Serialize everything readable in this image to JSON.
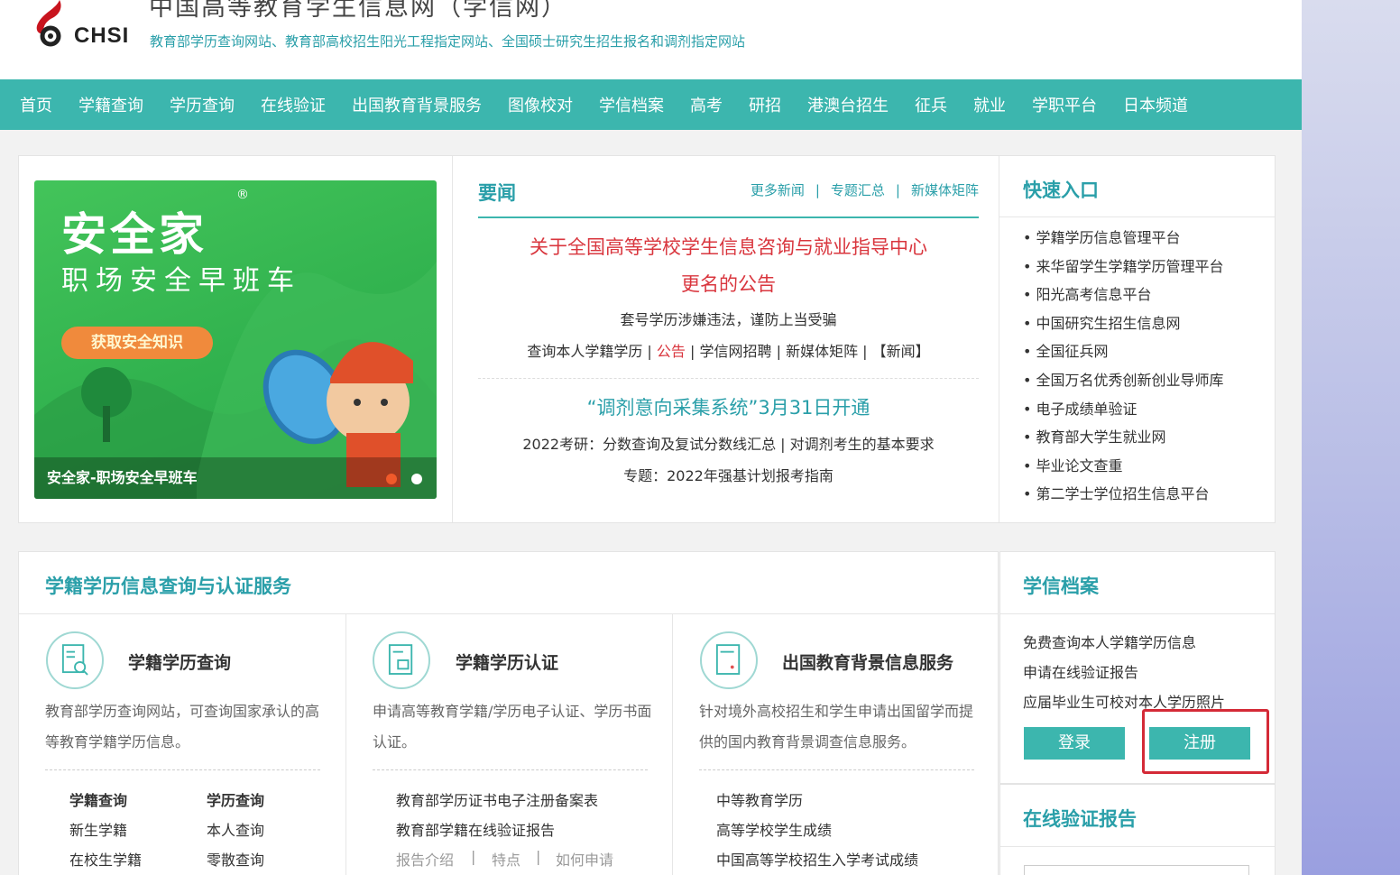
{
  "header": {
    "logo_text": "CHSI",
    "site_title": "中国高等教育学生信息网（学信网）",
    "site_subtitle": "教育部学历查询网站、教育部高校招生阳光工程指定网站、全国硕士研究生招生报名和调剂指定网站"
  },
  "nav": {
    "items": [
      "首页",
      "学籍查询",
      "学历查询",
      "在线验证",
      "出国教育背景服务",
      "图像校对",
      "学信档案",
      "高考",
      "研招",
      "港澳台招生",
      "征兵",
      "就业",
      "学职平台",
      "日本频道"
    ]
  },
  "banner": {
    "title": "安全家",
    "registered": "®",
    "subtitle": "职场安全早班车",
    "button": "获取安全知识",
    "caption": "安全家-职场安全早班车"
  },
  "news": {
    "title": "要闻",
    "links": [
      "更多新闻",
      "专题汇总",
      "新媒体矩阵"
    ],
    "separator": "|",
    "headline1_line1": "关于全国高等学校学生信息咨询与就业指导中心",
    "headline1_line2": "更名的公告",
    "line1": "套号学历涉嫌违法，谨防上当受骗",
    "line2_a": "查询本人学籍学历 | ",
    "line2_red": "公告",
    "line2_b": " | 学信网招聘 | 新媒体矩阵 | 【新闻】",
    "headline2": "“调剂意向采集系统”3月31日开通",
    "line3": "2022考研：分数查询及复试分数线汇总 | 对调剂考生的基本要求",
    "line4": "专题：2022年强基计划报考指南"
  },
  "quick": {
    "title": "快速入口",
    "items": [
      "• 学籍学历信息管理平台",
      "• 来华留学生学籍学历管理平台",
      "• 阳光高考信息平台",
      "• 中国研究生招生信息网",
      "• 全国征兵网",
      "• 全国万名优秀创新创业导师库",
      "• 电子成绩单验证",
      "• 教育部大学生就业网",
      "• 毕业论文查重",
      "• 第二学士学位招生信息平台"
    ]
  },
  "services": {
    "title": "学籍学历信息查询与认证服务",
    "cards": [
      {
        "title": "学籍学历查询",
        "desc": "教育部学历查询网站，可查询国家承认的高等教育学籍学历信息。",
        "col1": [
          "学籍查询",
          "新生学籍",
          "在校生学籍"
        ],
        "col2": [
          "学历查询",
          "本人查询",
          "零散查询"
        ]
      },
      {
        "title": "学籍学历认证",
        "desc": "申请高等教育学籍/学历电子认证、学历书面认证。",
        "rows": [
          "教育部学历证书电子注册备案表",
          "教育部学籍在线验证报告"
        ],
        "links": [
          "报告介绍",
          "特点",
          "如何申请"
        ],
        "sep": "|"
      },
      {
        "title": "出国教育背景信息服务",
        "desc": "针对境外高校招生和学生申请出国留学而提供的国内教育背景调查信息服务。",
        "rows": [
          "中等教育学历",
          "高等学校学生成绩",
          "中国高等学校招生入学考试成绩"
        ]
      }
    ]
  },
  "xuexin": {
    "title": "学信档案",
    "items": [
      "免费查询本人学籍学历信息",
      "申请在线验证报告",
      "应届毕业生可校对本人学历照片"
    ],
    "login": "登录",
    "register": "注册"
  },
  "online": {
    "title": "在线验证报告"
  }
}
